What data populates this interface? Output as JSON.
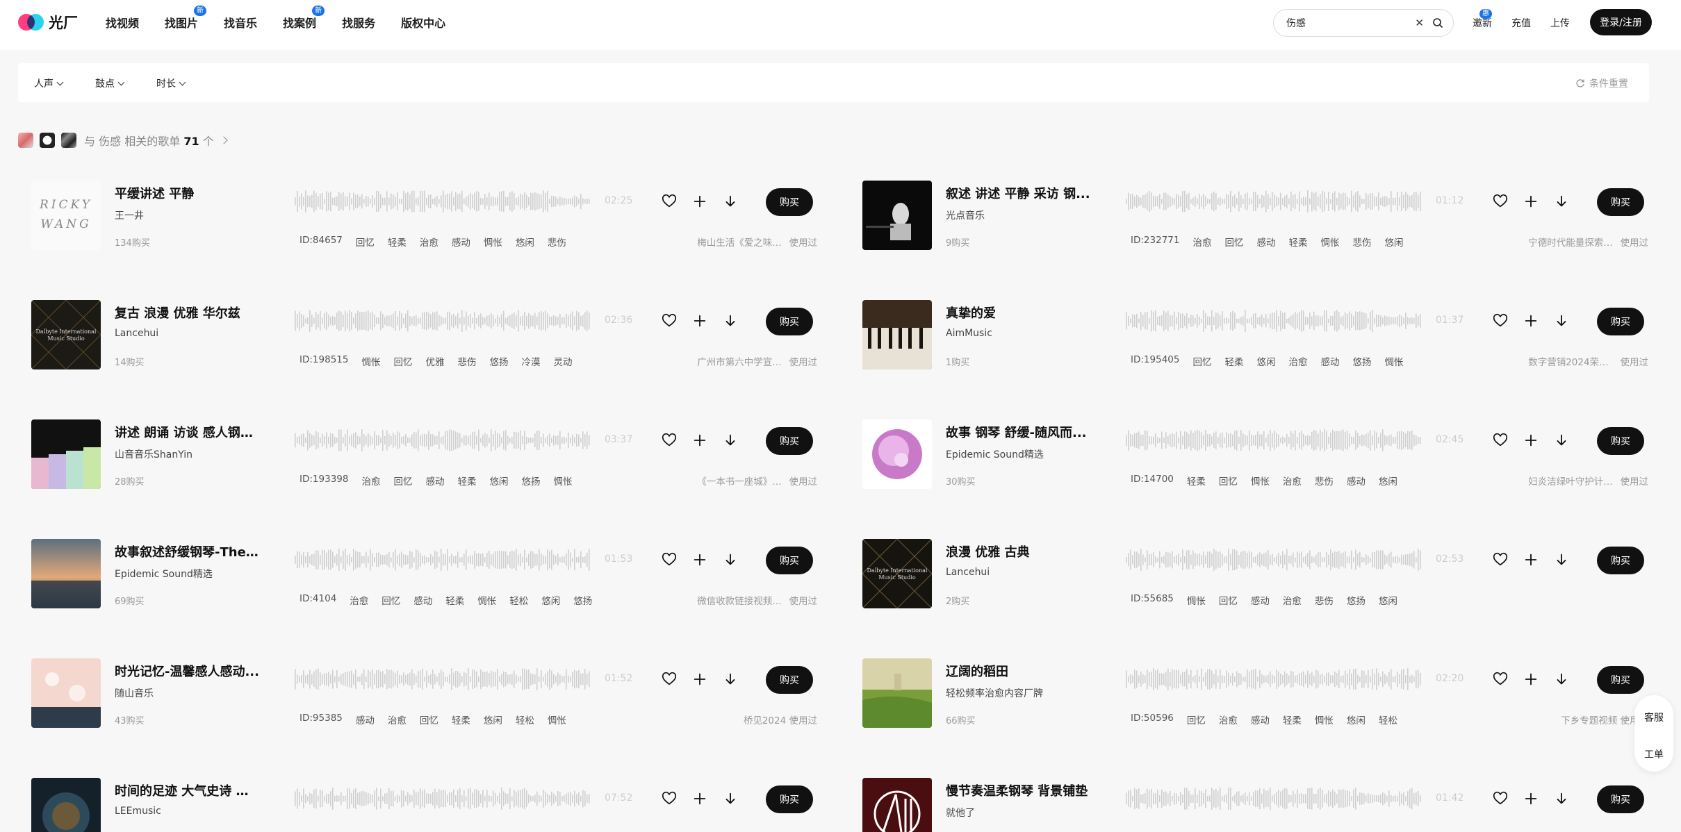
{
  "header": {
    "logo_text": "光厂",
    "nav": [
      {
        "label": "找视频",
        "badge": ""
      },
      {
        "label": "找图片",
        "badge": "新"
      },
      {
        "label": "找音乐",
        "badge": ""
      },
      {
        "label": "找案例",
        "badge": "新"
      },
      {
        "label": "找服务",
        "badge": ""
      },
      {
        "label": "版权中心",
        "badge": ""
      }
    ],
    "search_value": "伤感",
    "invite": {
      "label": "邀新",
      "badge": "惠"
    },
    "recharge": "充值",
    "upload": "上传",
    "login": "登录/注册"
  },
  "filters": {
    "items": [
      "人声",
      "鼓点",
      "时长"
    ],
    "reset": "条件重置"
  },
  "related": {
    "prefix": "与",
    "keyword": "伤感",
    "mid": "相关的歌单",
    "count": "71",
    "suffix": "个"
  },
  "buy_label": "购买",
  "used_label": "使用过",
  "tracks": [
    {
      "title": "平缓讲述 平静",
      "artist": "王一井",
      "buys": "134购买",
      "duration": "02:25",
      "id": "ID:84657",
      "tags": [
        "回忆",
        "轻柔",
        "治愈",
        "感动",
        "惆怅",
        "悠闲",
        "悲伤"
      ],
      "used_by": "梅山生活《爱之味》..."
    },
    {
      "title": "叙述 讲述 平静 采访 钢...",
      "artist": "光点音乐",
      "buys": "9购买",
      "duration": "01:12",
      "id": "ID:232771",
      "tags": [
        "治愈",
        "回忆",
        "感动",
        "轻柔",
        "惆怅",
        "悲伤",
        "悠闲"
      ],
      "used_by": "宁德时代能量探索家..."
    },
    {
      "title": "复古 浪漫 优雅 华尔兹",
      "artist": "Lancehui",
      "buys": "14购买",
      "duration": "02:36",
      "id": "ID:198515",
      "tags": [
        "惆怅",
        "回忆",
        "优雅",
        "悲伤",
        "悠扬",
        "冷漠",
        "灵动"
      ],
      "used_by": "广州市第六中学宣传..."
    },
    {
      "title": "真挚的爱",
      "artist": "AimMusic",
      "buys": "1购买",
      "duration": "01:37",
      "id": "ID:195405",
      "tags": [
        "回忆",
        "轻柔",
        "悠闲",
        "治愈",
        "感动",
        "悠扬",
        "惆怅"
      ],
      "used_by": "数字营销2024荣耀..."
    },
    {
      "title": "讲述 朗诵 访谈 感人钢琴曲",
      "artist": "山音音乐ShanYin",
      "buys": "28购买",
      "duration": "03:37",
      "id": "ID:193398",
      "tags": [
        "治愈",
        "回忆",
        "感动",
        "轻柔",
        "悠闲",
        "悠扬",
        "惆怅"
      ],
      "used_by": "《一本书一座城》宣..."
    },
    {
      "title": "故事 钢琴 舒缓-随风而...",
      "artist": "Epidemic Sound精选",
      "buys": "30购买",
      "duration": "02:45",
      "id": "ID:14700",
      "tags": [
        "轻柔",
        "回忆",
        "惆怅",
        "治愈",
        "悲伤",
        "感动",
        "悠闲"
      ],
      "used_by": "妇炎洁绿叶守护计划..."
    },
    {
      "title": "故事叙述舒缓钢琴-The ...",
      "artist": "Epidemic Sound精选",
      "buys": "69购买",
      "duration": "01:53",
      "id": "ID:4104",
      "tags": [
        "治愈",
        "回忆",
        "感动",
        "轻柔",
        "惆怅",
        "轻松",
        "悠闲",
        "悠扬"
      ],
      "used_by": "微信收款链接视频制作"
    },
    {
      "title": "浪漫 优雅 古典",
      "artist": "Lancehui",
      "buys": "2购买",
      "duration": "02:53",
      "id": "ID:55685",
      "tags": [
        "惆怅",
        "回忆",
        "感动",
        "治愈",
        "悲伤",
        "悠扬",
        "悠闲"
      ],
      "used_by": ""
    },
    {
      "title": "时光记忆-温馨感人感动...",
      "artist": "随山音乐",
      "buys": "43购买",
      "duration": "01:52",
      "id": "ID:95385",
      "tags": [
        "感动",
        "治愈",
        "回忆",
        "轻柔",
        "悠闲",
        "轻松",
        "惆怅"
      ],
      "used_by": "桥见2024"
    },
    {
      "title": "辽阔的稻田",
      "artist": "轻松频率治愈内容厂牌",
      "buys": "66购买",
      "duration": "02:20",
      "id": "ID:50596",
      "tags": [
        "回忆",
        "治愈",
        "感动",
        "轻柔",
        "惆怅",
        "悠闲",
        "轻松"
      ],
      "used_by": "下乡专题视频"
    },
    {
      "title": "时间的足迹 大气史诗 宣...",
      "artist": "LEEmusic",
      "buys": "",
      "duration": "07:52",
      "id": "",
      "tags": [],
      "used_by": ""
    },
    {
      "title": "慢节奏温柔钢琴 背景铺垫",
      "artist": "就他了",
      "buys": "",
      "duration": "01:42",
      "id": "",
      "tags": [],
      "used_by": ""
    }
  ],
  "side": {
    "service": "客服",
    "ticket": "工单"
  },
  "colors": {
    "accent": "#1a73e8",
    "primary_button": "#111111"
  }
}
